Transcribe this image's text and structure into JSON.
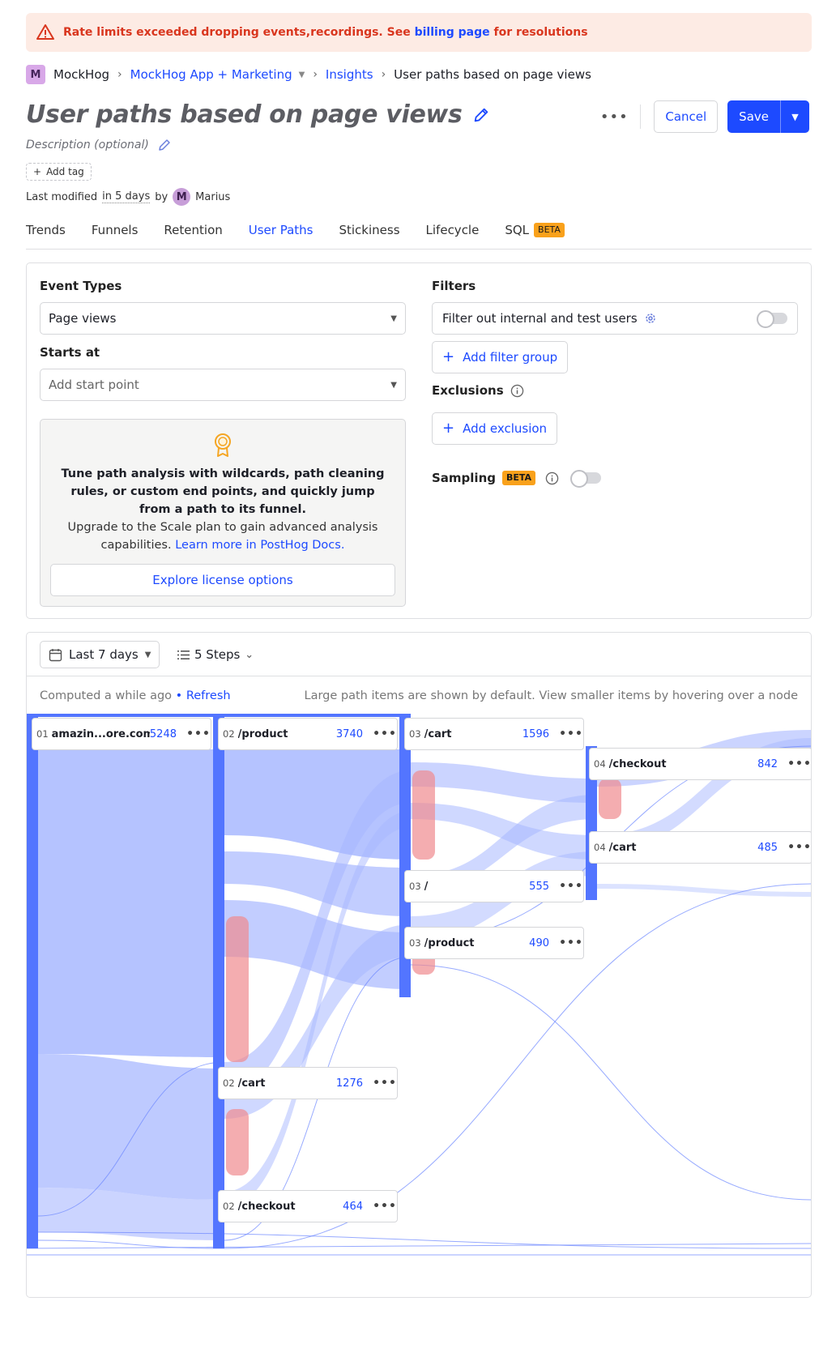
{
  "banner": {
    "text_before": "Rate limits exceeded dropping events,recordings. See ",
    "link": "billing page",
    "text_after": " for resolutions",
    "icon": "warning-triangle-icon"
  },
  "breadcrumbs": {
    "avatar_letter": "M",
    "org": "MockHog",
    "project": "MockHog App + Marketing",
    "section": "Insights",
    "current": "User paths based on page views"
  },
  "insight": {
    "title": "User paths based on page views",
    "description_placeholder": "Description (optional)",
    "add_tag": "Add tag",
    "modified_prefix": "Last modified",
    "modified_when": "in 5 days",
    "modified_by": "by",
    "author_initial": "M",
    "author": "Marius"
  },
  "actions": {
    "more": "•••",
    "cancel": "Cancel",
    "save": "Save"
  },
  "tabs": [
    {
      "label": "Trends"
    },
    {
      "label": "Funnels"
    },
    {
      "label": "Retention"
    },
    {
      "label": "User Paths",
      "active": true
    },
    {
      "label": "Stickiness"
    },
    {
      "label": "Lifecycle"
    },
    {
      "label": "SQL",
      "badge": "BETA"
    }
  ],
  "config": {
    "event_types_label": "Event Types",
    "event_types_value": "Page views",
    "starts_at_label": "Starts at",
    "starts_at_placeholder": "Add start point",
    "upsell": {
      "bold": "Tune path analysis with wildcards, path cleaning rules, or custom end points, and quickly jump from a path to its funnel.",
      "plain": "Upgrade to the Scale plan to gain advanced analysis capabilities.",
      "link": "Learn more in PostHog Docs.",
      "button": "Explore license options"
    },
    "filters_label": "Filters",
    "filter_internal": "Filter out internal and test users",
    "add_filter_group": "Add filter group",
    "exclusions_label": "Exclusions",
    "add_exclusion": "Add exclusion",
    "sampling_label": "Sampling",
    "sampling_badge": "BETA"
  },
  "results": {
    "date_range": "Last 7 days",
    "steps": "5 Steps",
    "computed": "Computed a while ago",
    "bullet": "•",
    "refresh": "Refresh",
    "hint": "Large path items are shown by default. View smaller items by hovering over a node",
    "nodes": [
      {
        "step": "01",
        "name": "amazin...ore.com/",
        "count": "5248"
      },
      {
        "step": "02",
        "name": "/product",
        "count": "3740"
      },
      {
        "step": "03",
        "name": "/cart",
        "count": "1596"
      },
      {
        "step": "04",
        "name": "/checkout",
        "count": "842"
      },
      {
        "step": "04",
        "name": "/cart",
        "count": "485"
      },
      {
        "step": "03",
        "name": "/",
        "count": "555"
      },
      {
        "step": "03",
        "name": "/product",
        "count": "490"
      },
      {
        "step": "02",
        "name": "/cart",
        "count": "1276"
      },
      {
        "step": "02",
        "name": "/checkout",
        "count": "464"
      }
    ],
    "colors": {
      "node_bar": "#5375ff",
      "flow": "#a8b8ff",
      "dropoff": "#f08a8f"
    }
  }
}
